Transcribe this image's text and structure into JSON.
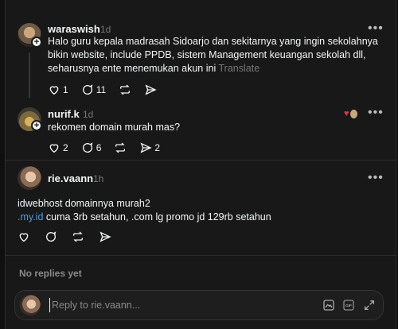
{
  "posts": [
    {
      "username": "waraswish",
      "time": "1d",
      "text": "Halo guru kepala madrasah Sidoarjo dan sekitarnya yang ingin sekolahnya bikin website, include PPDB, sistem Management keuangan sekolah dll, seharusnya ente menemukan akun ini",
      "translate": "Translate",
      "likes": "1",
      "comments": "11"
    },
    {
      "username": "nurif.k",
      "time": "1d",
      "text": "rekomen domain murah mas?",
      "likes": "2",
      "comments": "6",
      "shares": "2"
    },
    {
      "username": "rie.vaann",
      "time": "1h",
      "line1": "idwebhost domainnya murah2",
      "link": ".my.id",
      "line2_rest": " cuma 3rb setahun, .com lg promo jd 129rb setahun"
    }
  ],
  "no_replies": "No replies yet",
  "reply": {
    "placeholder": "Reply to rie.vaann..."
  },
  "icons": [
    "heart-icon",
    "comment-icon",
    "repost-icon",
    "send-icon",
    "more-icon",
    "image-icon",
    "gif-icon",
    "expand-icon"
  ]
}
